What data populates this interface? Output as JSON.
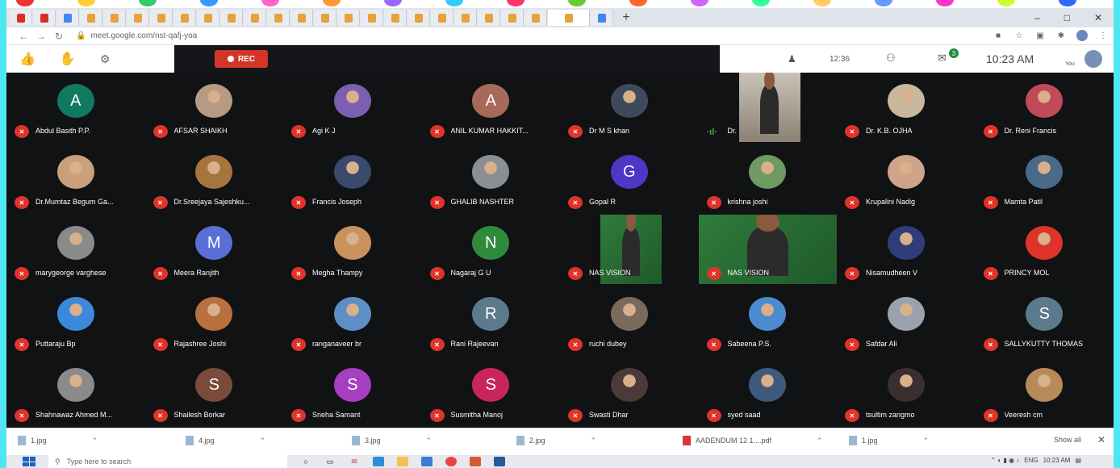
{
  "browser": {
    "url": "meet.google.com/nst-qafj-yoa",
    "tab_count_icons": [
      "M",
      "M",
      "G",
      "E",
      "E",
      "E",
      "E",
      "E",
      "E",
      "E",
      "E",
      "E",
      "E",
      "E",
      "E",
      "E",
      "E",
      "E",
      "E",
      "E",
      "E",
      "E",
      "E",
      "E",
      "G"
    ],
    "new_tab": "+",
    "window_controls": {
      "minimize": "–",
      "maximize": "□",
      "close": "✕"
    }
  },
  "meet": {
    "recording_label": "REC",
    "time_left": "12:36",
    "clock": "10:23 AM",
    "you_label": "You",
    "chat_badge": "3",
    "participants": [
      {
        "name": "Abdul Basith P.P.",
        "initial": "A",
        "color": "#0f7a5f",
        "kind": "initial"
      },
      {
        "name": "AFSAR SHAIKH",
        "kind": "photo",
        "color": "#b59a84"
      },
      {
        "name": "Agi K J",
        "kind": "photo",
        "color": "#7c5fb0"
      },
      {
        "name": "ANIL KUMAR HAKKIT...",
        "initial": "A",
        "color": "#a86a58",
        "kind": "initial"
      },
      {
        "name": "Dr M S khan",
        "kind": "photo",
        "color": "#3e4a5c"
      },
      {
        "name": "Dr.",
        "kind": "video-office",
        "speaking": true
      },
      {
        "name": "Dr. K.B. OJHA",
        "kind": "photo",
        "color": "#c7b79c"
      },
      {
        "name": "Dr. Reni Francis",
        "kind": "photo",
        "color": "#c04a58"
      },
      {
        "name": "Dr.Mumtaz Begum Ga...",
        "kind": "photo",
        "color": "#caa07c"
      },
      {
        "name": "Dr.Sreejaya Sajeshku...",
        "kind": "photo",
        "color": "#a6753e"
      },
      {
        "name": "Francis Joseph",
        "kind": "photo",
        "color": "#394a6b"
      },
      {
        "name": "GHALIB NASHTER",
        "kind": "photo",
        "color": "#8a8f96"
      },
      {
        "name": "Gopal R",
        "initial": "G",
        "color": "#4e36c7",
        "kind": "initial"
      },
      {
        "name": "krishna joshi",
        "kind": "photo",
        "color": "#6e9a64"
      },
      {
        "name": "Krupalini Nadig",
        "kind": "photo",
        "color": "#d0a48a"
      },
      {
        "name": "Mamta Patil",
        "kind": "photo",
        "color": "#4a6a8a"
      },
      {
        "name": "marygeorge varghese",
        "kind": "photo",
        "color": "#8a8a8a"
      },
      {
        "name": "Meera Ranjith",
        "initial": "M",
        "color": "#5a6fd6",
        "kind": "initial"
      },
      {
        "name": "Megha Thampy",
        "kind": "photo",
        "color": "#c9915c"
      },
      {
        "name": "Nagaraj G U",
        "initial": "N",
        "color": "#2f8a3c",
        "kind": "initial"
      },
      {
        "name": "NAS VISION",
        "kind": "video-green"
      },
      {
        "name": "NAS VISION",
        "kind": "video-green"
      },
      {
        "name": "Nisamudheen V",
        "kind": "photo",
        "color": "#2f3e7a"
      },
      {
        "name": "PRINCY MOL",
        "kind": "photo",
        "color": "#e0332a"
      },
      {
        "name": "Puttaraju Bp",
        "kind": "photo",
        "color": "#3b8ad9"
      },
      {
        "name": "Rajashree Joshi",
        "kind": "photo",
        "color": "#b9703e"
      },
      {
        "name": "ranganaveer br",
        "kind": "photo",
        "color": "#5c8fc6"
      },
      {
        "name": "Rani Rajeevan",
        "initial": "R",
        "color": "#5b7a8c",
        "kind": "initial"
      },
      {
        "name": "ruchi dubey",
        "kind": "photo",
        "color": "#7a6a5c"
      },
      {
        "name": "Sabeena P.S.",
        "kind": "photo",
        "color": "#4a8ccf"
      },
      {
        "name": "Safdar Ali",
        "kind": "photo",
        "color": "#9aa3ad"
      },
      {
        "name": "SALLYKUTTY THOMAS",
        "initial": "S",
        "color": "#5b7a8c",
        "kind": "initial"
      },
      {
        "name": "Shahnawaz Ahmed M...",
        "kind": "photo",
        "color": "#8a8a8a"
      },
      {
        "name": "Shailesh Borkar",
        "initial": "S",
        "color": "#7a4a3a",
        "kind": "initial"
      },
      {
        "name": "Sneha Samant",
        "initial": "S",
        "color": "#a63fc2",
        "kind": "initial"
      },
      {
        "name": "Susmitha Manoj",
        "initial": "S",
        "color": "#c8255e",
        "kind": "initial"
      },
      {
        "name": "Swasti Dhar",
        "kind": "photo",
        "color": "#4a3a3a"
      },
      {
        "name": "syed saad",
        "kind": "photo",
        "color": "#3e5a7a"
      },
      {
        "name": "tsultim zangmo",
        "kind": "photo",
        "color": "#3a2f2f"
      },
      {
        "name": "Veeresh cm",
        "kind": "photo",
        "color": "#b88a5a"
      }
    ]
  },
  "downloads": {
    "items": [
      "1.jpg",
      "4.jpg",
      "3.jpg",
      "2.jpg",
      "AADENDUM 12 1....pdf",
      "1.jpg"
    ],
    "show_all": "Show all",
    "close": "✕"
  },
  "taskbar": {
    "search_placeholder": "Type here to search",
    "tray_lang": "ENG",
    "tray_time": "10:23 AM"
  }
}
